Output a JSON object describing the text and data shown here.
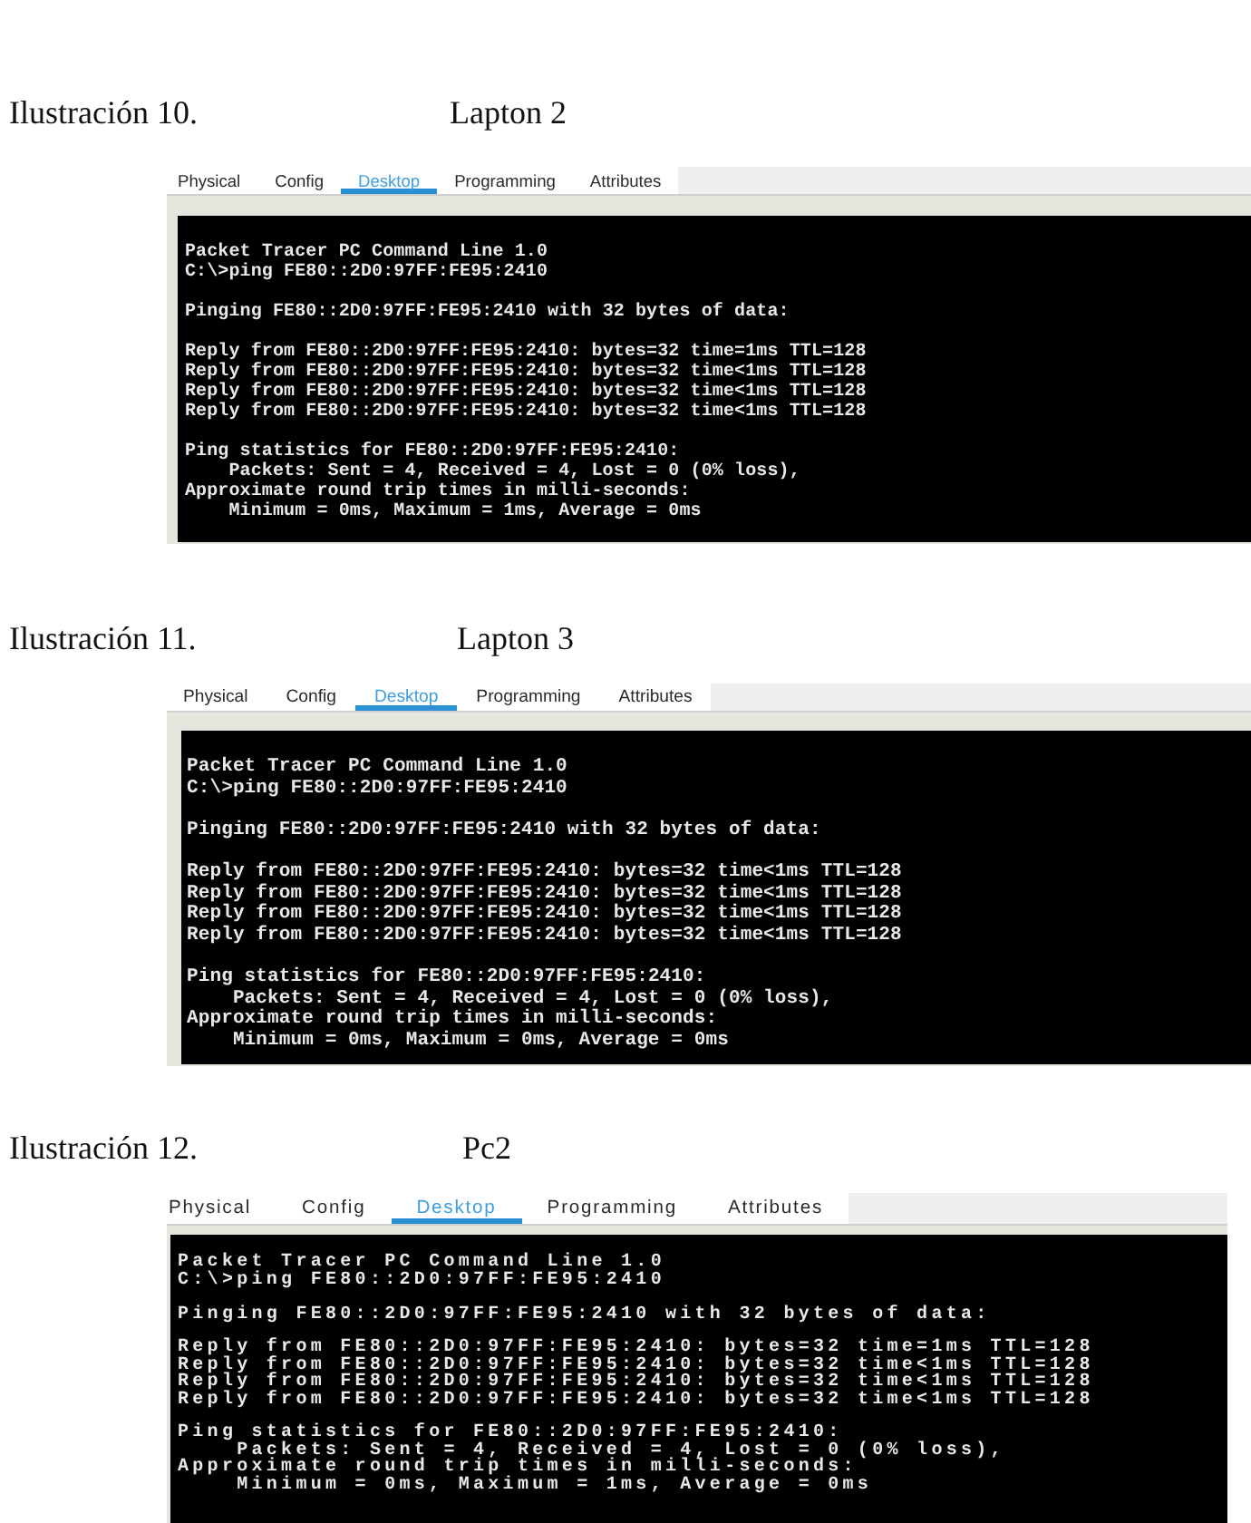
{
  "figures": [
    {
      "label": "Ilustración 10.",
      "title": "Lapton 2",
      "tabs": [
        {
          "label": "Physical",
          "selected": false
        },
        {
          "label": "Config",
          "selected": false
        },
        {
          "label": "Desktop",
          "selected": true
        },
        {
          "label": "Programming",
          "selected": false
        },
        {
          "label": "Attributes",
          "selected": false
        }
      ],
      "terminal": {
        "blocks": [
          [
            {
              "text": "Packet Tracer PC Command Line 1.0",
              "indented": false
            },
            {
              "text": "C:\\>ping FE80::2D0:97FF:FE95:2410",
              "indented": false
            }
          ],
          [
            {
              "text": "Pinging FE80::2D0:97FF:FE95:2410 with 32 bytes of data:",
              "indented": false
            }
          ],
          [
            {
              "text": "Reply from FE80::2D0:97FF:FE95:2410: bytes=32 time=1ms TTL=128",
              "indented": false
            },
            {
              "text": "Reply from FE80::2D0:97FF:FE95:2410: bytes=32 time<1ms TTL=128",
              "indented": false
            },
            {
              "text": "Reply from FE80::2D0:97FF:FE95:2410: bytes=32 time<1ms TTL=128",
              "indented": false
            },
            {
              "text": "Reply from FE80::2D0:97FF:FE95:2410: bytes=32 time<1ms TTL=128",
              "indented": false
            }
          ],
          [
            {
              "text": "Ping statistics for FE80::2D0:97FF:FE95:2410:",
              "indented": false
            },
            {
              "text": "Packets: Sent = 4, Received = 4, Lost = 0 (0% loss),",
              "indented": true
            },
            {
              "text": "Approximate round trip times in milli-seconds:",
              "indented": false
            },
            {
              "text": "Minimum = 0ms, Maximum = 1ms, Average = 0ms",
              "indented": true
            }
          ]
        ]
      }
    },
    {
      "label": "Ilustración 11.",
      "title": "Lapton 3",
      "tabs": [
        {
          "label": "Physical",
          "selected": false
        },
        {
          "label": "Config",
          "selected": false
        },
        {
          "label": "Desktop",
          "selected": true
        },
        {
          "label": "Programming",
          "selected": false
        },
        {
          "label": "Attributes",
          "selected": false
        }
      ],
      "terminal": {
        "blocks": [
          [
            {
              "text": "Packet Tracer PC Command Line 1.0",
              "indented": false
            },
            {
              "text": "C:\\>ping FE80::2D0:97FF:FE95:2410",
              "indented": false
            }
          ],
          [
            {
              "text": "Pinging FE80::2D0:97FF:FE95:2410 with 32 bytes of data:",
              "indented": false
            }
          ],
          [
            {
              "text": "Reply from FE80::2D0:97FF:FE95:2410: bytes=32 time<1ms TTL=128",
              "indented": false
            },
            {
              "text": "Reply from FE80::2D0:97FF:FE95:2410: bytes=32 time<1ms TTL=128",
              "indented": false
            },
            {
              "text": "Reply from FE80::2D0:97FF:FE95:2410: bytes=32 time<1ms TTL=128",
              "indented": false
            },
            {
              "text": "Reply from FE80::2D0:97FF:FE95:2410: bytes=32 time<1ms TTL=128",
              "indented": false
            }
          ],
          [
            {
              "text": "Ping statistics for FE80::2D0:97FF:FE95:2410:",
              "indented": false
            },
            {
              "text": "Packets: Sent = 4, Received = 4, Lost = 0 (0% loss),",
              "indented": true
            },
            {
              "text": "Approximate round trip times in milli-seconds:",
              "indented": false
            },
            {
              "text": "Minimum = 0ms, Maximum = 0ms, Average = 0ms",
              "indented": true
            }
          ]
        ]
      }
    },
    {
      "label": "Ilustración 12.",
      "title": "Pc2",
      "tabs": [
        {
          "label": "Physical",
          "selected": false
        },
        {
          "label": "Config",
          "selected": false
        },
        {
          "label": "Desktop",
          "selected": true
        },
        {
          "label": "Programming",
          "selected": false
        },
        {
          "label": "Attributes",
          "selected": false
        }
      ],
      "terminal": {
        "blocks": [
          [
            {
              "text": "Packet Tracer PC Command Line 1.0",
              "indented": false
            },
            {
              "text": "C:\\>ping FE80::2D0:97FF:FE95:2410",
              "indented": false
            }
          ],
          [
            {
              "text": "Pinging FE80::2D0:97FF:FE95:2410 with 32 bytes of data:",
              "indented": false
            }
          ],
          [
            {
              "text": "Reply from FE80::2D0:97FF:FE95:2410: bytes=32 time=1ms TTL=128",
              "indented": false
            },
            {
              "text": "Reply from FE80::2D0:97FF:FE95:2410: bytes=32 time<1ms TTL=128",
              "indented": false
            },
            {
              "text": "Reply from FE80::2D0:97FF:FE95:2410: bytes=32 time<1ms TTL=128",
              "indented": false
            },
            {
              "text": "Reply from FE80::2D0:97FF:FE95:2410: bytes=32 time<1ms TTL=128",
              "indented": false
            }
          ],
          [
            {
              "text": "Ping statistics for FE80::2D0:97FF:FE95:2410:",
              "indented": false
            },
            {
              "text": "Packets: Sent = 4, Received = 4, Lost = 0 (0% loss),",
              "indented": true
            },
            {
              "text": "Approximate round trip times in milli-seconds:",
              "indented": false
            },
            {
              "text": "Minimum = 0ms, Maximum = 1ms, Average = 0ms",
              "indented": true
            }
          ]
        ]
      }
    }
  ]
}
